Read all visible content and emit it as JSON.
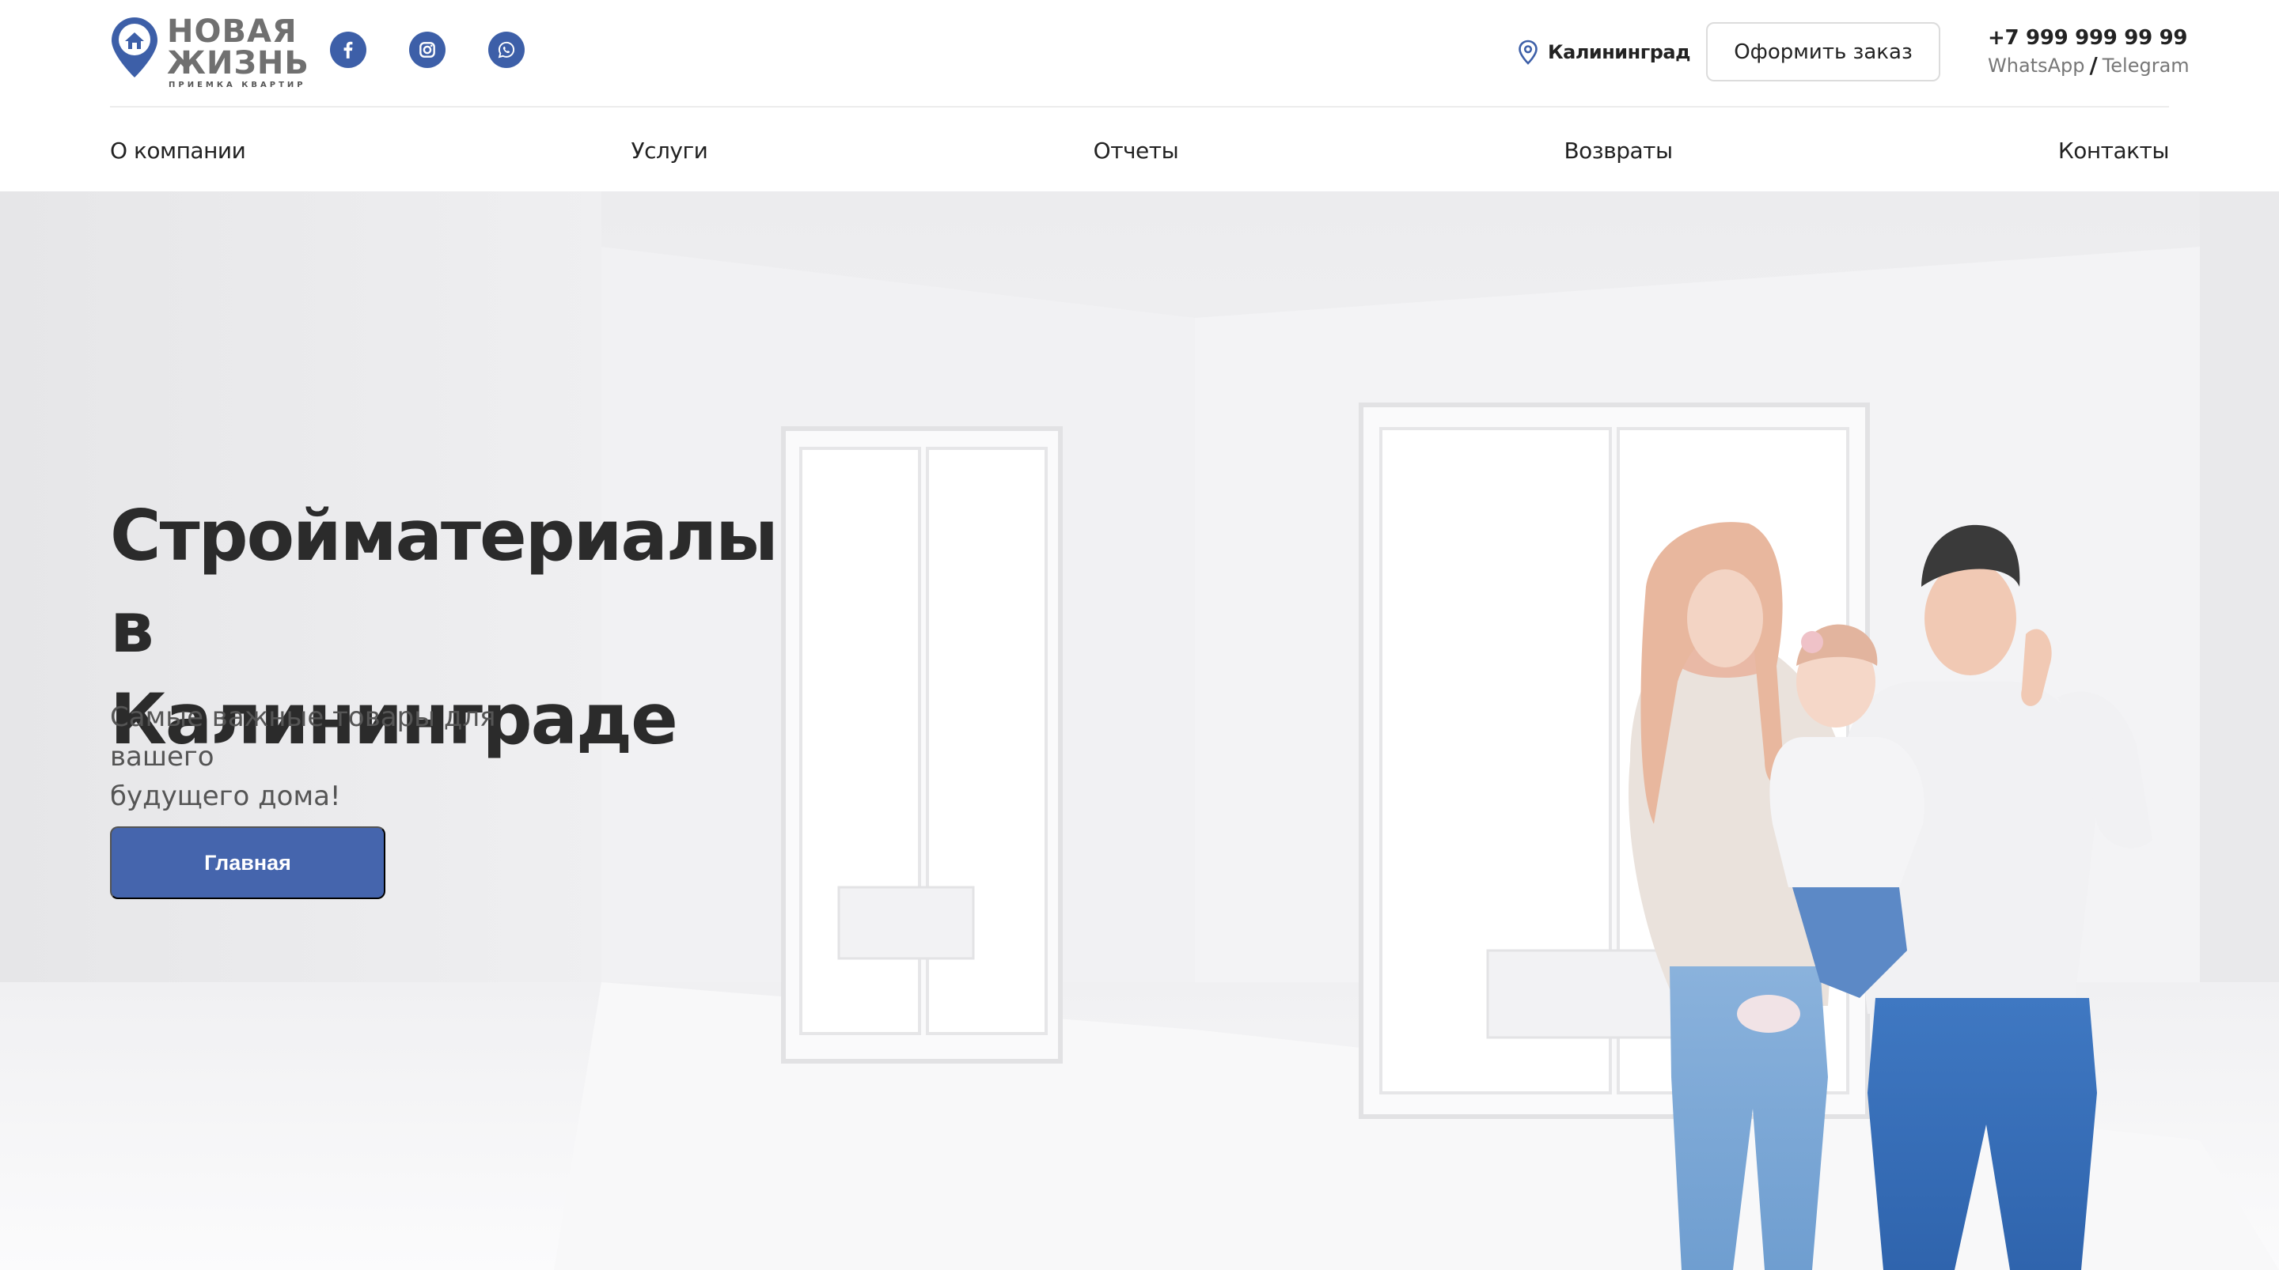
{
  "brand": {
    "name_line1": "НОВАЯ",
    "name_line2": "ЖИЗНЬ",
    "tagline": "ПРИЕМКА КВАРТИР",
    "accent_color": "#3d5fa8"
  },
  "social": [
    {
      "name": "facebook-icon"
    },
    {
      "name": "instagram-icon"
    },
    {
      "name": "whatsapp-icon"
    }
  ],
  "header": {
    "city": "Калининград",
    "order_button": "Оформить заказ",
    "phone": "+7 999 999 99 99",
    "messenger_1": "WhatsApp",
    "messenger_sep": "/",
    "messenger_2": "Telegram"
  },
  "nav": {
    "items": [
      {
        "label": "О компании"
      },
      {
        "label": "Услуги"
      },
      {
        "label": "Отчеты"
      },
      {
        "label": "Возвраты"
      },
      {
        "label": "Контакты"
      }
    ]
  },
  "hero": {
    "title_line1": "Стройматериалы в",
    "title_line2": "Калининграде",
    "subtitle_line1": "Самые важные товары для вашего",
    "subtitle_line2": "будущего дома!",
    "button": "Главная",
    "button_color": "#4565ad"
  }
}
